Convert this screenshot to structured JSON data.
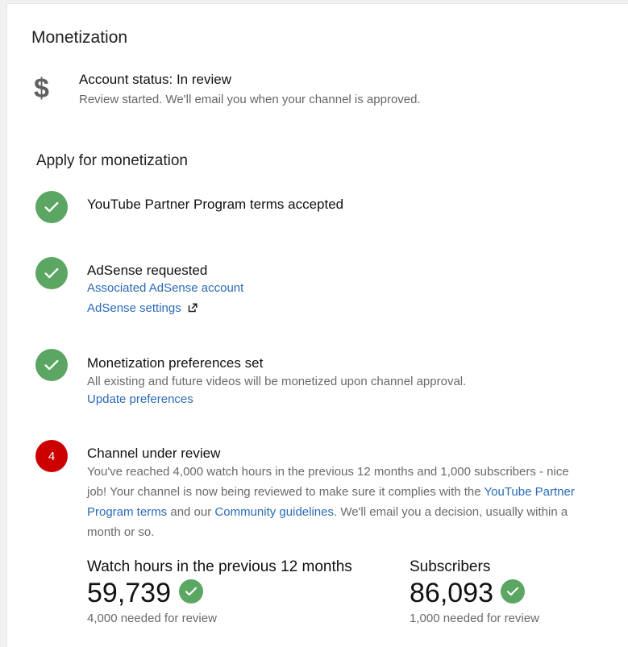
{
  "header": {
    "title": "Monetization"
  },
  "account": {
    "icon": "dollar-icon",
    "dollar_glyph": "$",
    "status": "Account status: In review",
    "detail": "Review started. We'll email you when your channel is approved."
  },
  "apply": {
    "title": "Apply for monetization",
    "steps": [
      {
        "title": "YouTube Partner Program terms accepted",
        "done": true
      },
      {
        "title": "AdSense requested",
        "done": true,
        "links": [
          "Associated AdSense account",
          "AdSense settings"
        ]
      },
      {
        "title": "Monetization preferences set",
        "done": true,
        "detail": "All existing and future videos will be monetized upon channel approval.",
        "link": "Update preferences"
      },
      {
        "title": "Channel under review",
        "number": "4",
        "done": false,
        "para_1": "You've reached 4,000 watch hours in the previous 12 months and 1,000 subscribers - nice job! Your channel is now being reviewed to make sure it complies with the",
        "link_1": "YouTube Partner Program terms",
        "para_2": "and our",
        "link_2": "Community guidelines",
        "para_3": ". We'll email you a decision, usually within a month or so."
      }
    ]
  },
  "stats": {
    "watch_hours": {
      "label": "Watch hours in the previous 12 months",
      "value": "59,739",
      "needed": "4,000 needed for review"
    },
    "subscribers": {
      "label": "Subscribers",
      "value": "86,093",
      "needed": "1,000 needed for review"
    }
  },
  "colors": {
    "success": "#5ba663",
    "alert": "#cc0000",
    "link": "#2a6ab7"
  }
}
